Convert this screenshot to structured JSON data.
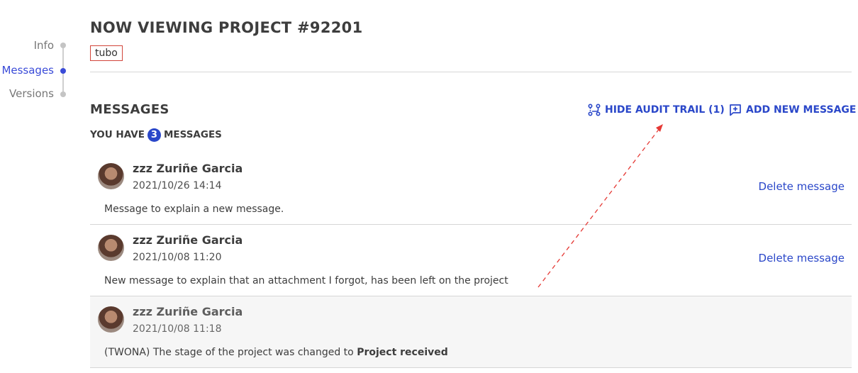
{
  "sidenav": {
    "items": [
      {
        "label": "Info",
        "active": false
      },
      {
        "label": "Messages",
        "active": true
      },
      {
        "label": "Versions",
        "active": false
      }
    ]
  },
  "header": {
    "title": "NOW VIEWING PROJECT #92201",
    "tag": "tubo"
  },
  "messages_section": {
    "title": "MESSAGES",
    "hide_audit_trail_label": "HIDE AUDIT TRAIL (1)",
    "add_new_message_label": "ADD NEW MESSAGE",
    "count_prefix": "YOU HAVE",
    "count": "3",
    "count_suffix": "MESSAGES"
  },
  "messages": [
    {
      "author": "zzz Zuriñe Garcia",
      "date": "2021/10/26 14:14",
      "body": "Message to explain a new message.",
      "delete_label": "Delete message"
    },
    {
      "author": "zzz Zuriñe Garcia",
      "date": "2021/10/08 11:20",
      "body": "New message to explain that an attachment I forgot, has been left on the project",
      "delete_label": "Delete message"
    },
    {
      "author": "zzz Zuriñe Garcia",
      "date": "2021/10/08 11:18",
      "body_prefix": "(TWONA) The stage of the project was changed to",
      "body_strong": "Project received"
    }
  ],
  "colors": {
    "accent": "#2a47c9",
    "nav_active": "#3a4bd8",
    "tag_border": "#d2453a",
    "annotation_arrow": "#e53935"
  }
}
